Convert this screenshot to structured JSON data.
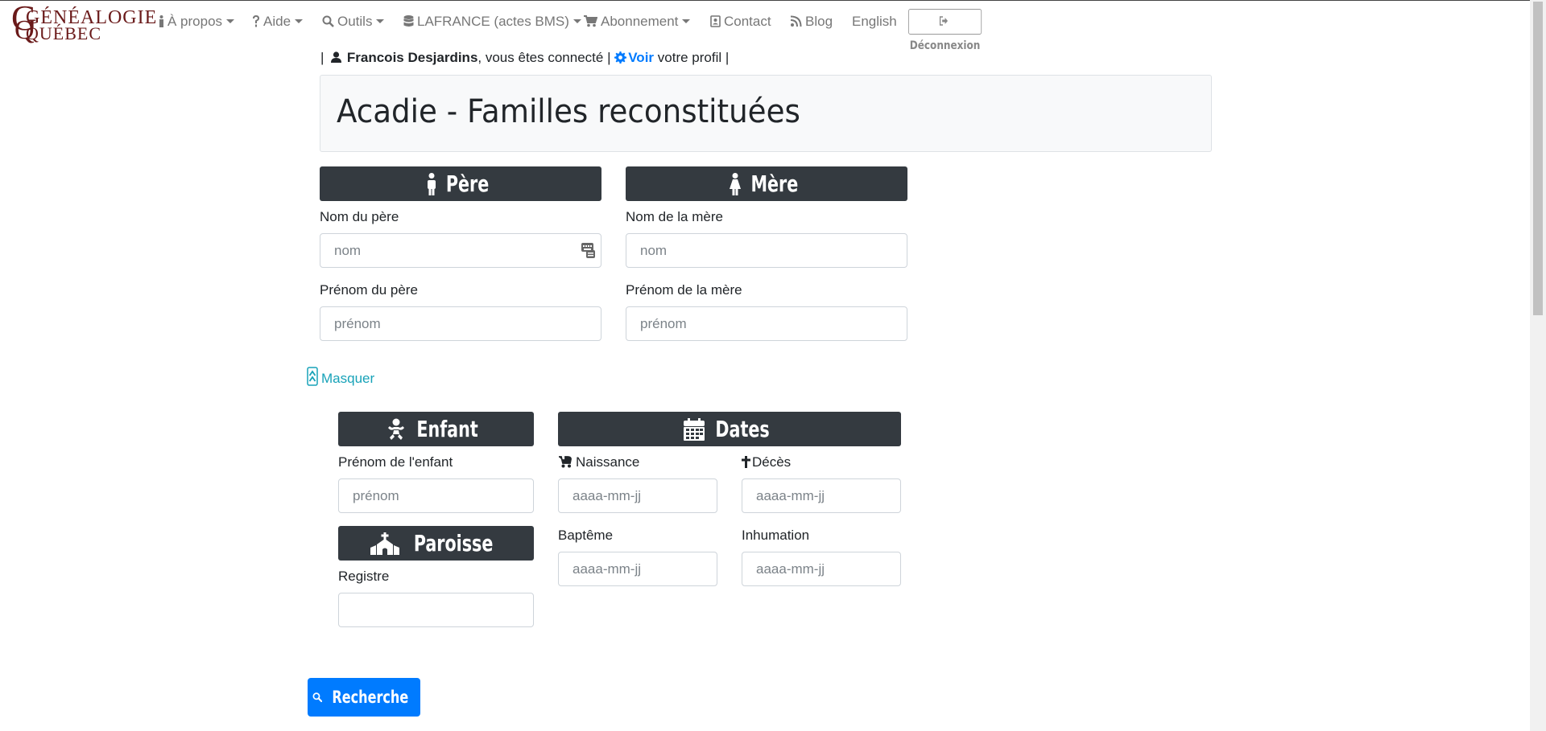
{
  "logo": {
    "line1": "GÉNÉALOGIE",
    "line2": "QUÉBEC",
    "big_g": "G",
    "big_q": "Q",
    "color": "#6a1a1a"
  },
  "nav": {
    "apropos": "À propos",
    "aide": "Aide",
    "outils": "Outils",
    "lafrance": "LAFRANCE (actes BMS)",
    "abonnement": "Abonnement",
    "contact": "Contact",
    "blog": "Blog",
    "english": "English",
    "logout": "Déconnexion"
  },
  "user_line": {
    "sep1": "|",
    "user_name": "Francois Desjardins",
    "connected": ", vous êtes connecté",
    "sep2": "|",
    "voir": "Voir",
    "profile_text": "votre profil",
    "sep3": "|"
  },
  "page_title": "Acadie - Familles reconstituées",
  "father": {
    "header": "Père",
    "nom_label": "Nom du père",
    "nom_placeholder": "nom",
    "prenom_label": "Prénom du père",
    "prenom_placeholder": "prénom"
  },
  "mother": {
    "header": "Mère",
    "nom_label": "Nom de la mère",
    "nom_placeholder": "nom",
    "prenom_label": "Prénom de la mère",
    "prenom_placeholder": "prénom"
  },
  "toggle_label": "Masquer",
  "child": {
    "header": "Enfant",
    "prenom_label": "Prénom de l'enfant",
    "prenom_placeholder": "prénom"
  },
  "parish": {
    "header": "Paroisse",
    "registre_label": "Registre",
    "registre_value": ""
  },
  "dates": {
    "header": "Dates",
    "naissance_label": "Naissance",
    "deces_label": "Décès",
    "bapteme_label": "Baptême",
    "inhumation_label": "Inhumation",
    "date_placeholder": "aaaa-mm-jj"
  },
  "search_button": "Recherche",
  "colors": {
    "header_bg": "#343a40",
    "primary": "#007bff",
    "info": "#17a2b8",
    "nav_text": "#777777"
  }
}
